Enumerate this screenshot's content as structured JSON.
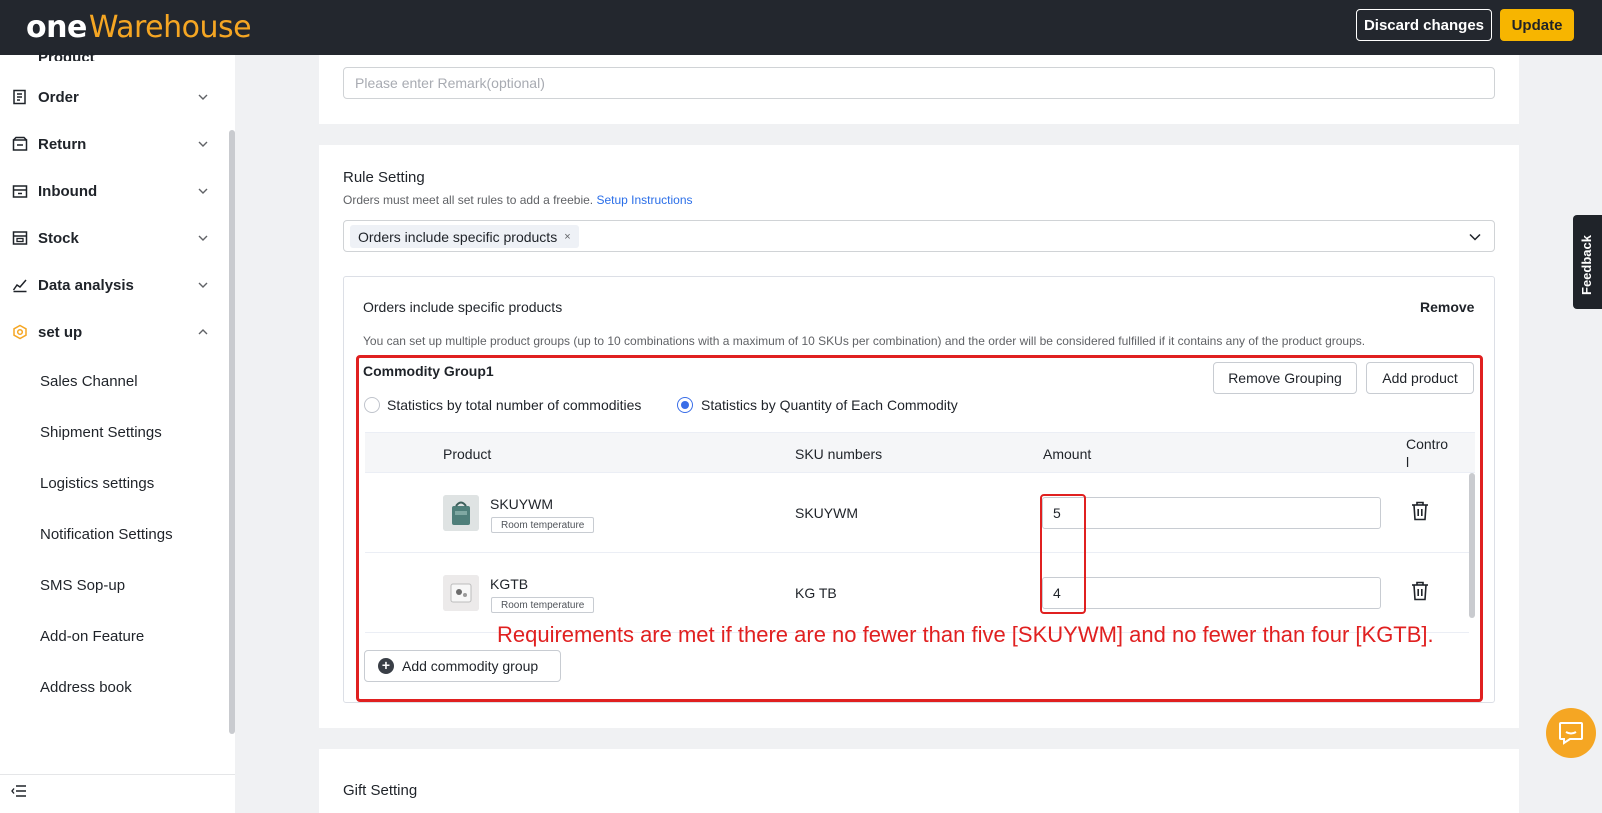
{
  "app": {
    "logo_one": "one",
    "logo_warehouse": "Warehouse"
  },
  "header": {
    "discard_label": "Discard changes",
    "update_label": "Update"
  },
  "sidebar": {
    "partial_item": "Product",
    "items": [
      {
        "label": "Order",
        "icon": "order-icon"
      },
      {
        "label": "Return",
        "icon": "return-icon"
      },
      {
        "label": "Inbound",
        "icon": "inbound-icon"
      },
      {
        "label": "Stock",
        "icon": "stock-icon"
      },
      {
        "label": "Data analysis",
        "icon": "chart-icon"
      },
      {
        "label": "set up",
        "icon": "setup-icon"
      }
    ],
    "subitems": [
      "Sales Channel",
      "Shipment Settings",
      "Logistics settings",
      "Notification Settings",
      "SMS Sop-up",
      "Add-on Feature",
      "Address book"
    ]
  },
  "remark": {
    "placeholder": "Please enter Remark(optional)"
  },
  "rule": {
    "title": "Rule Setting",
    "desc": "Orders must meet all set rules to add a freebie.",
    "link": "Setup Instructions",
    "selected_tag": "Orders include specific products",
    "tag_close": "×"
  },
  "products_rule": {
    "title": "Orders include specific products",
    "remove_label": "Remove",
    "desc": "You can set up multiple product groups (up to 10 combinations with a maximum of 10 SKUs per combination) and the order will be considered fulfilled if it contains any of the product groups."
  },
  "group": {
    "title": "Commodity Group1",
    "remove_grouping": "Remove Grouping",
    "add_product": "Add product",
    "radio_total": "Statistics by total number of commodities",
    "radio_each": "Statistics by Quantity of Each Commodity",
    "selected_radio": "each"
  },
  "table": {
    "headers": {
      "product": "Product",
      "sku": "SKU numbers",
      "amount": "Amount",
      "control_1": "Contro",
      "control_2": "l"
    },
    "rows": [
      {
        "name": "SKUYWM",
        "tag": "Room temperature",
        "sku": "SKUYWM",
        "amount": "5"
      },
      {
        "name": "KGTB",
        "tag": "Room temperature",
        "sku": "KG TB",
        "amount": "4"
      }
    ]
  },
  "annotation": "Requirements are met if there are no fewer than five [SKUYWM] and no fewer than four [KGTB].",
  "add_group_label": "Add commodity group",
  "gift": {
    "title": "Gift Setting"
  },
  "feedback": "Feedback",
  "colors": {
    "topbar": "#23272e",
    "accent": "#f7b500",
    "link": "#2a6ee8",
    "annotation": "#e02020"
  }
}
